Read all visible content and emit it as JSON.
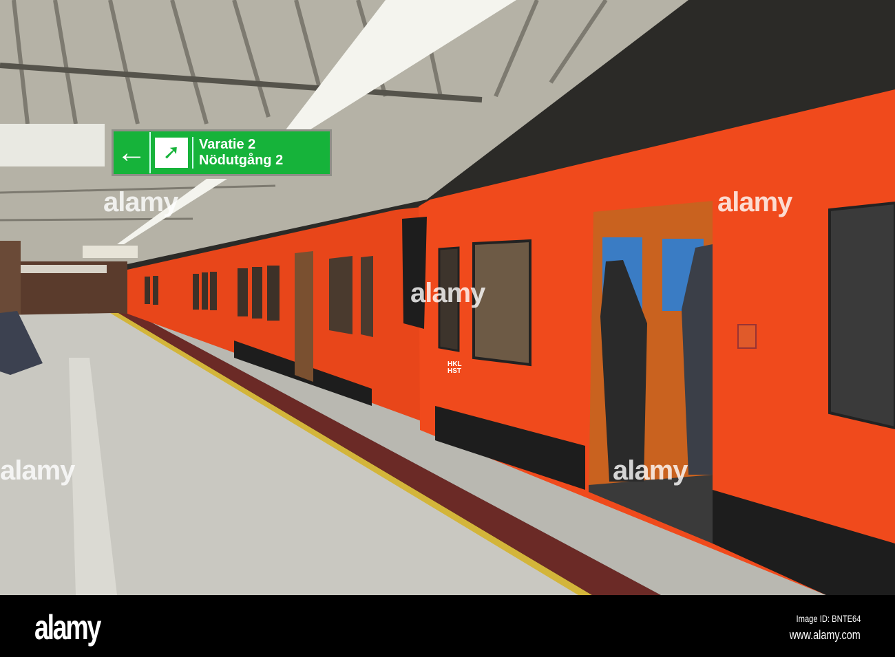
{
  "scene": {
    "description_colors": {
      "train": "#f04a1c",
      "sign": "#16b33a",
      "floor": "#c8c7c0",
      "wall": "#2b2a27",
      "ceiling": "#b9b6aa"
    },
    "sign": {
      "arrow_icon": "arrow-left-icon",
      "exit_icon": "running-person-exit-icon",
      "line1": "Varatie 2",
      "line2": "Nödutgång 2"
    },
    "train_logo": {
      "line1": "HKL",
      "line2": "HST"
    },
    "watermark": "alamy"
  },
  "footer": {
    "brand": "alamy",
    "image_id": "Image ID: BNTE64",
    "url": "www.alamy.com"
  }
}
